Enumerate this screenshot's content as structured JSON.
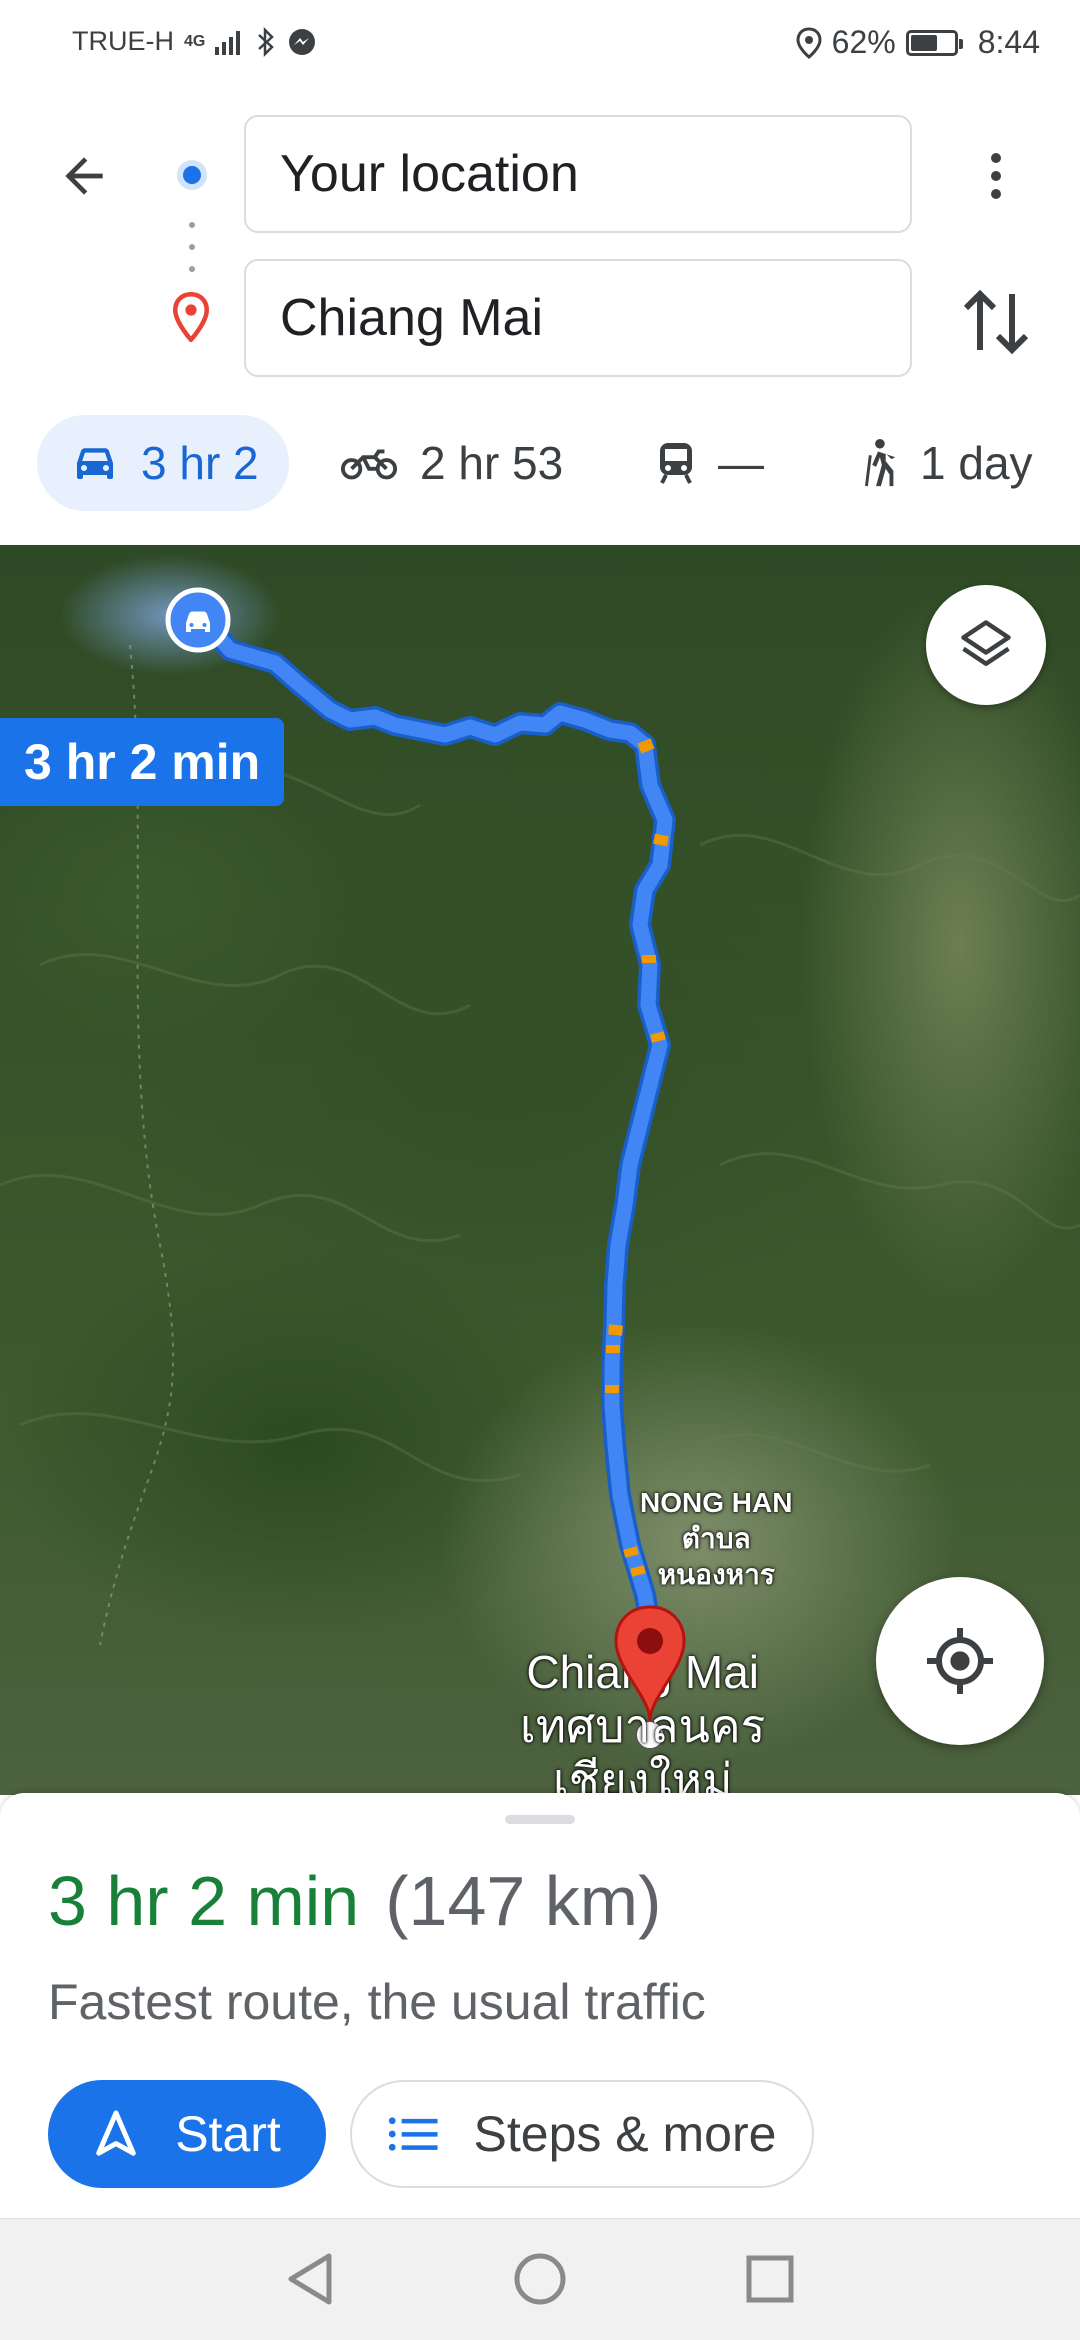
{
  "status_bar": {
    "carrier": "TRUE-H",
    "network": "4G",
    "battery_percent": "62%",
    "battery_level": 0.62,
    "time": "8:44"
  },
  "directions": {
    "origin": "Your location",
    "destination": "Chiang Mai"
  },
  "modes": [
    {
      "name": "drive",
      "icon": "car-icon",
      "label": "3 hr 2",
      "active": true
    },
    {
      "name": "motorcycle",
      "icon": "motorcycle-icon",
      "label": "2 hr 53",
      "active": false
    },
    {
      "name": "transit",
      "icon": "train-icon",
      "label": "—",
      "active": false
    },
    {
      "name": "walk",
      "icon": "walk-icon",
      "label": "1 day",
      "active": false
    }
  ],
  "map": {
    "route_duration_tag": "3 hr 2 min",
    "route_color": "#4285f4",
    "labels": {
      "nong_han": [
        "NONG HAN",
        "ตำบล",
        "หนองหาร"
      ],
      "city": [
        "Chiang Mai",
        "เทศบาลนคร",
        "เชียงใหม่"
      ]
    }
  },
  "sheet": {
    "duration": "3 hr 2 min",
    "distance": "(147 km)",
    "description": "Fastest route, the usual traffic",
    "start_label": "Start",
    "steps_label": "Steps & more"
  },
  "colors": {
    "primary": "#1a73e8",
    "duration_green": "#188038",
    "destination_red": "#ea4335"
  }
}
